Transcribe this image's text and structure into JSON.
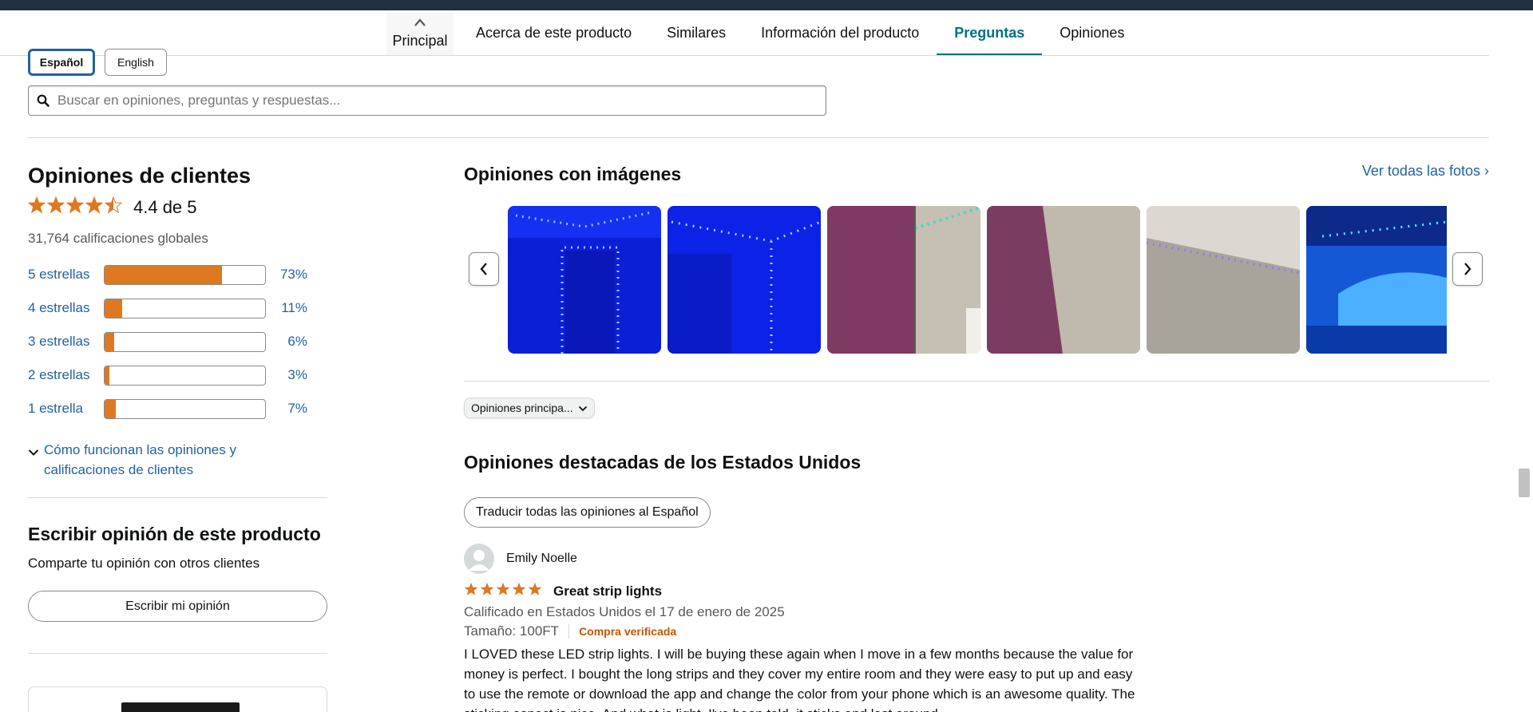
{
  "nav": {
    "back_label": "Principal",
    "tabs": [
      {
        "label": "Acerca de este producto"
      },
      {
        "label": "Similares"
      },
      {
        "label": "Información del producto"
      },
      {
        "label": "Preguntas",
        "active": true
      },
      {
        "label": "Opiniones"
      }
    ]
  },
  "languages": [
    {
      "label": "Español",
      "selected": true
    },
    {
      "label": "English",
      "selected": false
    }
  ],
  "search": {
    "placeholder": "Buscar en opiniones, preguntas y respuestas..."
  },
  "summary": {
    "title": "Opiniones de clientes",
    "rating": 4.4,
    "rating_text": "4.4 de 5",
    "global_count": "31,764 calificaciones globales",
    "histogram": [
      {
        "label": "5 estrellas",
        "percent": 73,
        "pct_text": "73%"
      },
      {
        "label": "4 estrellas",
        "percent": 11,
        "pct_text": "11%"
      },
      {
        "label": "3 estrellas",
        "percent": 6,
        "pct_text": "6%"
      },
      {
        "label": "2 estrellas",
        "percent": 3,
        "pct_text": "3%"
      },
      {
        "label": "1 estrella",
        "percent": 7,
        "pct_text": "7%"
      }
    ],
    "how_it_works": "Cómo funcionan las opiniones y calificaciones de clientes"
  },
  "write_review": {
    "title": "Escribir opinión de este producto",
    "subtitle": "Comparte tu opinión con otros clientes",
    "button": "Escribir mi opinión"
  },
  "images_section": {
    "title": "Opiniones con imágenes",
    "see_all": "Ver todas las fotos ›",
    "thumbnails": [
      {
        "desc": "blue LED strip around door and ceiling"
      },
      {
        "desc": "blue LED strip along wall corner"
      },
      {
        "desc": "teal LED lights at ceiling corner with purple wall"
      },
      {
        "desc": "purple wall and beige wall corner"
      },
      {
        "desc": "purple LED lights along ceiling edge"
      },
      {
        "desc": "blue-lit room with bed and ceiling lights"
      }
    ]
  },
  "sort": {
    "selected": "Opiniones principa..."
  },
  "us_reviews": {
    "title": "Opiniones destacadas de los Estados Unidos",
    "translate_button": "Traducir todas las opiniones al Español"
  },
  "review": {
    "author": "Emily Noelle",
    "stars": 5,
    "title": "Great strip lights",
    "date": "Calificado en Estados Unidos el 17 de enero de 2025",
    "size": "Tamaño: 100FT",
    "verified": "Compra verificada",
    "body": "I LOVED these LED strip lights. I will be buying these again when I move in a few months because the value for money is perfect. I bought the long strips and they cover my entire room and they were easy to put up and easy to use the remote or download the app and change the color from your phone which is an awesome quality. The sticking aspect is nice. And what is light, I've been told, it sticks and last around"
  },
  "colors": {
    "link": "#2162a1",
    "teal_active": "#007185",
    "star_orange": "#de7921",
    "verified_orange": "#c45500"
  }
}
